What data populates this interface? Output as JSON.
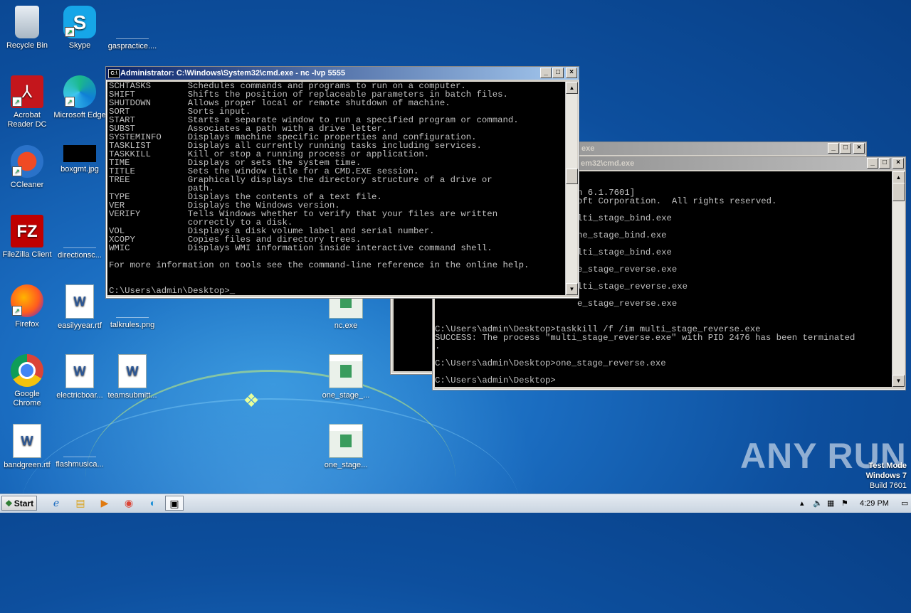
{
  "desktop": {
    "icons": [
      {
        "label": "Recycle Bin",
        "icon": "recycle-bin-icon"
      },
      {
        "label": "Skype",
        "icon": "skype-icon"
      },
      {
        "label": "gaspractice....",
        "icon": "file-icon"
      },
      {
        "label": "Acrobat Reader DC",
        "icon": "acrobat-icon"
      },
      {
        "label": "Microsoft Edge",
        "icon": "edge-icon"
      },
      {
        "label": "CCleaner",
        "icon": "ccleaner-icon"
      },
      {
        "label": "boxgmt.jpg",
        "icon": "image-file-icon"
      },
      {
        "label": "FileZilla Client",
        "icon": "filezilla-icon"
      },
      {
        "label": "directionsc...",
        "icon": "file-icon"
      },
      {
        "label": "Firefox",
        "icon": "firefox-icon"
      },
      {
        "label": "easilyyear.rtf",
        "icon": "word-doc-icon"
      },
      {
        "label": "talkrules.png",
        "icon": "image-file-icon"
      },
      {
        "label": "nc.exe",
        "icon": "exe-icon"
      },
      {
        "label": "Google Chrome",
        "icon": "chrome-icon"
      },
      {
        "label": "electricboar...",
        "icon": "word-doc-icon"
      },
      {
        "label": "teamsubmitt...",
        "icon": "word-doc-icon"
      },
      {
        "label": "one_stage_...",
        "icon": "exe-icon"
      },
      {
        "label": "bandgreen.rtf",
        "icon": "word-doc-icon"
      },
      {
        "label": "flashmusica...",
        "icon": "file-icon"
      },
      {
        "label": "one_stage...",
        "icon": "exe-icon"
      }
    ]
  },
  "windows": {
    "main_cmd": {
      "title": "Administrator: C:\\Windows\\System32\\cmd.exe - nc  -lvp 5555",
      "lines": [
        "SCHTASKS       Schedules commands and programs to run on a computer.",
        "SHIFT          Shifts the position of replaceable parameters in batch files.",
        "SHUTDOWN       Allows proper local or remote shutdown of machine.",
        "SORT           Sorts input.",
        "START          Starts a separate window to run a specified program or command.",
        "SUBST          Associates a path with a drive letter.",
        "SYSTEMINFO     Displays machine specific properties and configuration.",
        "TASKLIST       Displays all currently running tasks including services.",
        "TASKKILL       Kill or stop a running process or application.",
        "TIME           Displays or sets the system time.",
        "TITLE          Sets the window title for a CMD.EXE session.",
        "TREE           Graphically displays the directory structure of a drive or",
        "               path.",
        "TYPE           Displays the contents of a text file.",
        "VER            Displays the Windows version.",
        "VERIFY         Tells Windows whether to verify that your files are written",
        "               correctly to a disk.",
        "VOL            Displays a disk volume label and serial number.",
        "XCOPY          Copies files and directory trees.",
        "WMIC           Displays WMI information inside interactive command shell.",
        "",
        "For more information on tools see the command-line reference in the online help.",
        "",
        "",
        "C:\\Users\\admin\\Desktop>_"
      ]
    },
    "back_cmd": {
      "title": "exe"
    },
    "second_cmd": {
      "title": "em32\\cmd.exe",
      "lines": [
        "n 6.1.7601]",
        "oft Corporation.  All rights reserved.",
        "",
        "lti_stage_bind.exe",
        "",
        "ne_stage_bind.exe",
        "",
        "lti_stage_bind.exe",
        "",
        "e_stage_reverse.exe",
        "",
        "lti_stage_reverse.exe",
        "",
        "e_stage_reverse.exe"
      ],
      "full_lines": [
        "C:\\Users\\admin\\Desktop>taskkill /f /im multi_stage_reverse.exe",
        "SUCCESS: The process \"multi_stage_reverse.exe\" with PID 2476 has been terminated",
        ".",
        "",
        "C:\\Users\\admin\\Desktop>one_stage_reverse.exe",
        "",
        "C:\\Users\\admin\\Desktop>"
      ]
    }
  },
  "watermark": {
    "brand": "ANY RUN",
    "test_mode": "Test Mode",
    "os": "Windows 7",
    "build": "Build 7601"
  },
  "taskbar": {
    "start_label": "Start",
    "clock": "4:29 PM"
  }
}
